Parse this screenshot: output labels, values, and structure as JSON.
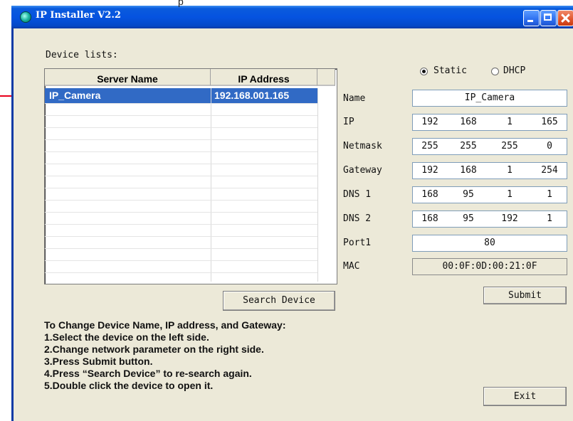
{
  "above_window_text": "p",
  "window": {
    "title": "IP Installer V2.2"
  },
  "device_list": {
    "label": "Device lists:",
    "columns": [
      "Server Name",
      "IP Address"
    ],
    "rows": [
      {
        "name": "IP_Camera",
        "ip": "192.168.001.165",
        "selected": true
      }
    ]
  },
  "search_button": "Search Device",
  "mode": {
    "options": [
      "Static",
      "DHCP"
    ],
    "selected": "Static"
  },
  "form": {
    "name": {
      "label": "Name",
      "value": "IP_Camera"
    },
    "ip": {
      "label": "IP",
      "octets": [
        "192",
        "168",
        "1",
        "165"
      ]
    },
    "netmask": {
      "label": "Netmask",
      "octets": [
        "255",
        "255",
        "255",
        "0"
      ]
    },
    "gateway": {
      "label": "Gateway",
      "octets": [
        "192",
        "168",
        "1",
        "254"
      ]
    },
    "dns1": {
      "label": "DNS 1",
      "octets": [
        "168",
        "95",
        "1",
        "1"
      ]
    },
    "dns2": {
      "label": "DNS 2",
      "octets": [
        "168",
        "95",
        "192",
        "1"
      ]
    },
    "port1": {
      "label": "Port1",
      "value": "80"
    },
    "mac": {
      "label": "MAC",
      "value": "00:0F:0D:00:21:0F"
    }
  },
  "submit_button": "Submit",
  "exit_button": "Exit",
  "instructions": [
    "To Change Device Name, IP address, and Gateway:",
    "1.Select the device on the left side.",
    "2.Change network parameter on the right side.",
    "3.Press Submit button.",
    "4.Press “Search Device” to re-search again.",
    "5.Double click the device to open it."
  ],
  "colors": {
    "arrow": "#e8001c",
    "selection": "#316ac5",
    "titlebar": "#0553e0"
  }
}
